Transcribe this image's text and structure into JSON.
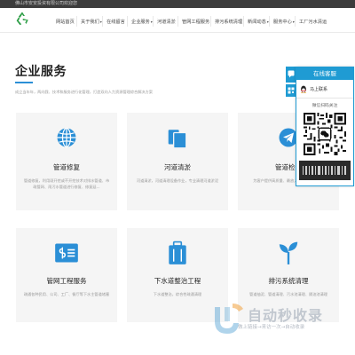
{
  "topbar": {
    "text": "佛山市安安投资有限公司欢迎您"
  },
  "nav": {
    "items": [
      {
        "label": "网站首页",
        "caret": false
      },
      {
        "label": "关于我们",
        "caret": true
      },
      {
        "label": "在线留言",
        "caret": false
      },
      {
        "label": "企业服务",
        "caret": true
      },
      {
        "label": "河道清淤",
        "caret": false
      },
      {
        "label": "管网工程服务",
        "caret": false
      },
      {
        "label": "排污系统清理",
        "caret": false
      },
      {
        "label": "新闻动态",
        "caret": true
      },
      {
        "label": "服务中心",
        "caret": true
      },
      {
        "label": "工厂污水清运",
        "caret": false
      }
    ]
  },
  "section": {
    "title": "企业服务",
    "subtitle": "成立当年年，两向我、技术和服务进行化管理，打造双向人力资源管理综合解决方案"
  },
  "cards": [
    {
      "title": "管道修复",
      "desc": "管道修复，利用顽开挖或不开挖技术对排水管道、市政管网、雨污水管道进行修复、修复延..."
    },
    {
      "title": "河道清淤",
      "desc": "河道清淤，河道清理设备作业，专业清理河道淤泥"
    },
    {
      "title": "管道检测",
      "desc": "为客户提供高质量、最放入、排管检测评估"
    },
    {
      "title": "管网工程服务",
      "desc": "疏通各种民用、公司、工厂、餐厅等下水主管道堵塞"
    },
    {
      "title": "下水道整治工程",
      "desc": "下水道整治，综合性疏通清理"
    },
    {
      "title": "排污系统清理",
      "desc": "管道抽泥、管道清理、污水池清理、隔油池清理"
    }
  ],
  "panel": {
    "header": "在线客服",
    "qq_label": "马上联系",
    "scan_text": "微信扫码关注"
  },
  "watermark": {
    "main": "自动秒收录",
    "sub": "做上链接→来访一次→自动收录"
  },
  "colors": {
    "accent": "#1f9bd3",
    "logo": "#2e9e47",
    "icon": "#2b8fd6"
  }
}
